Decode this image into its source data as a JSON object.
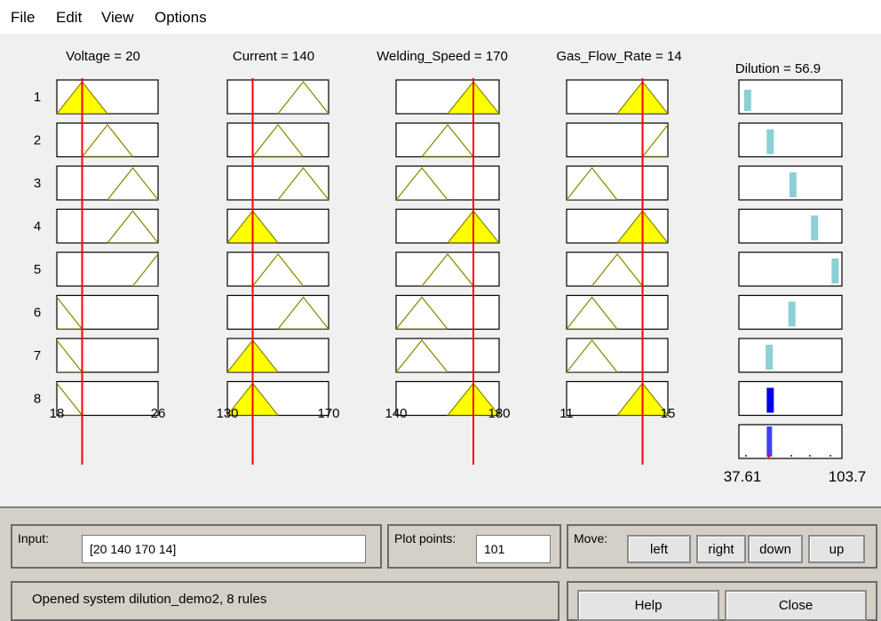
{
  "menu": {
    "items": [
      "File",
      "Edit",
      "View",
      "Options"
    ]
  },
  "variables": [
    {
      "header": "Voltage = 20",
      "range_min": "18",
      "range_max": "26",
      "input_value": 20,
      "min": 18,
      "max": 26
    },
    {
      "header": "Current = 140",
      "range_min": "130",
      "range_max": "170",
      "input_value": 140,
      "min": 130,
      "max": 170
    },
    {
      "header": "Welding_Speed = 170",
      "range_min": "140",
      "range_max": "180",
      "input_value": 170,
      "min": 140,
      "max": 180
    },
    {
      "header": "Gas_Flow_Rate = 14",
      "range_min": "11",
      "range_max": "15",
      "input_value": 14,
      "min": 11,
      "max": 15
    }
  ],
  "output": {
    "header": "Dilution = 56.9",
    "range_min": "37.61",
    "range_max": "103.7"
  },
  "rules": [
    "1",
    "2",
    "3",
    "4",
    "5",
    "6",
    "7",
    "8"
  ],
  "bottom": {
    "input_label": "Input:",
    "input_value": "[20 140 170 14]",
    "plot_points_label": "Plot points:",
    "plot_points_value": "101",
    "move_label": "Move:",
    "left": "left",
    "right": "right",
    "down": "down",
    "up": "up",
    "status": "Opened system dilution_demo2, 8 rules",
    "help": "Help",
    "close": "Close"
  },
  "colors": {
    "fill": "#ffff00",
    "outline": "#8c8c00",
    "cursor": "#ff0000",
    "output_bar": "#8ccfd4",
    "aggregate": "#0000e6"
  }
}
